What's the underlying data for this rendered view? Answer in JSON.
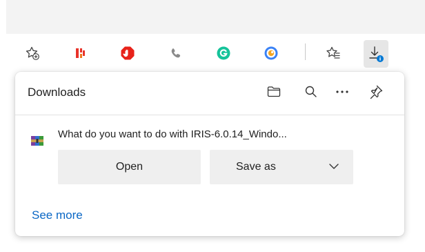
{
  "toolbar": {
    "icons": [
      "add-favorite-icon",
      "extension-red-icon",
      "adblock-icon",
      "phone-icon",
      "grammarly-icon",
      "extension-blue-icon",
      "favorites-icon",
      "downloads-icon"
    ],
    "accent": "#0078d4"
  },
  "downloads_panel": {
    "title": "Downloads",
    "header_icons": [
      "folder-icon",
      "search-icon",
      "more-options-icon",
      "pin-icon"
    ],
    "item": {
      "message": "What do you want to do with IRIS-6.0.14_Windo...",
      "open_label": "Open",
      "save_as_label": "Save as"
    },
    "see_more_label": "See more"
  },
  "colors": {
    "link": "#0a67c5",
    "button_bg": "#efefef",
    "tabstrip_bg": "#f3f3f3"
  }
}
